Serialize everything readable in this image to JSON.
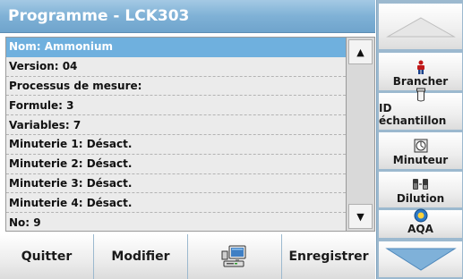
{
  "title": "Programme - LCK303",
  "list_items": [
    "Nom: Ammonium",
    "Version: 04",
    "Processus de mesure:",
    "Formule: 3",
    "Variables: 7",
    "Minuterie 1: Désact.",
    "Minuterie 2: Désact.",
    "Minuterie 3: Désact.",
    "Minuterie 4: Désact.",
    "No: 9"
  ],
  "selected_index": 0,
  "sidebar": {
    "brancher": "Brancher",
    "id_echantillon": "ID échantillon",
    "minuteur": "Minuteur",
    "dilution": "Dilution",
    "aqa": "AQA"
  },
  "bottom": {
    "quitter": "Quitter",
    "modifier": "Modifier",
    "enregistrer": "Enregistrer"
  },
  "colors": {
    "title_bar": "#7fb1d6",
    "selection": "#6fb0de",
    "frame": "#9cb9cf",
    "arrow": "#7fb1d9"
  }
}
